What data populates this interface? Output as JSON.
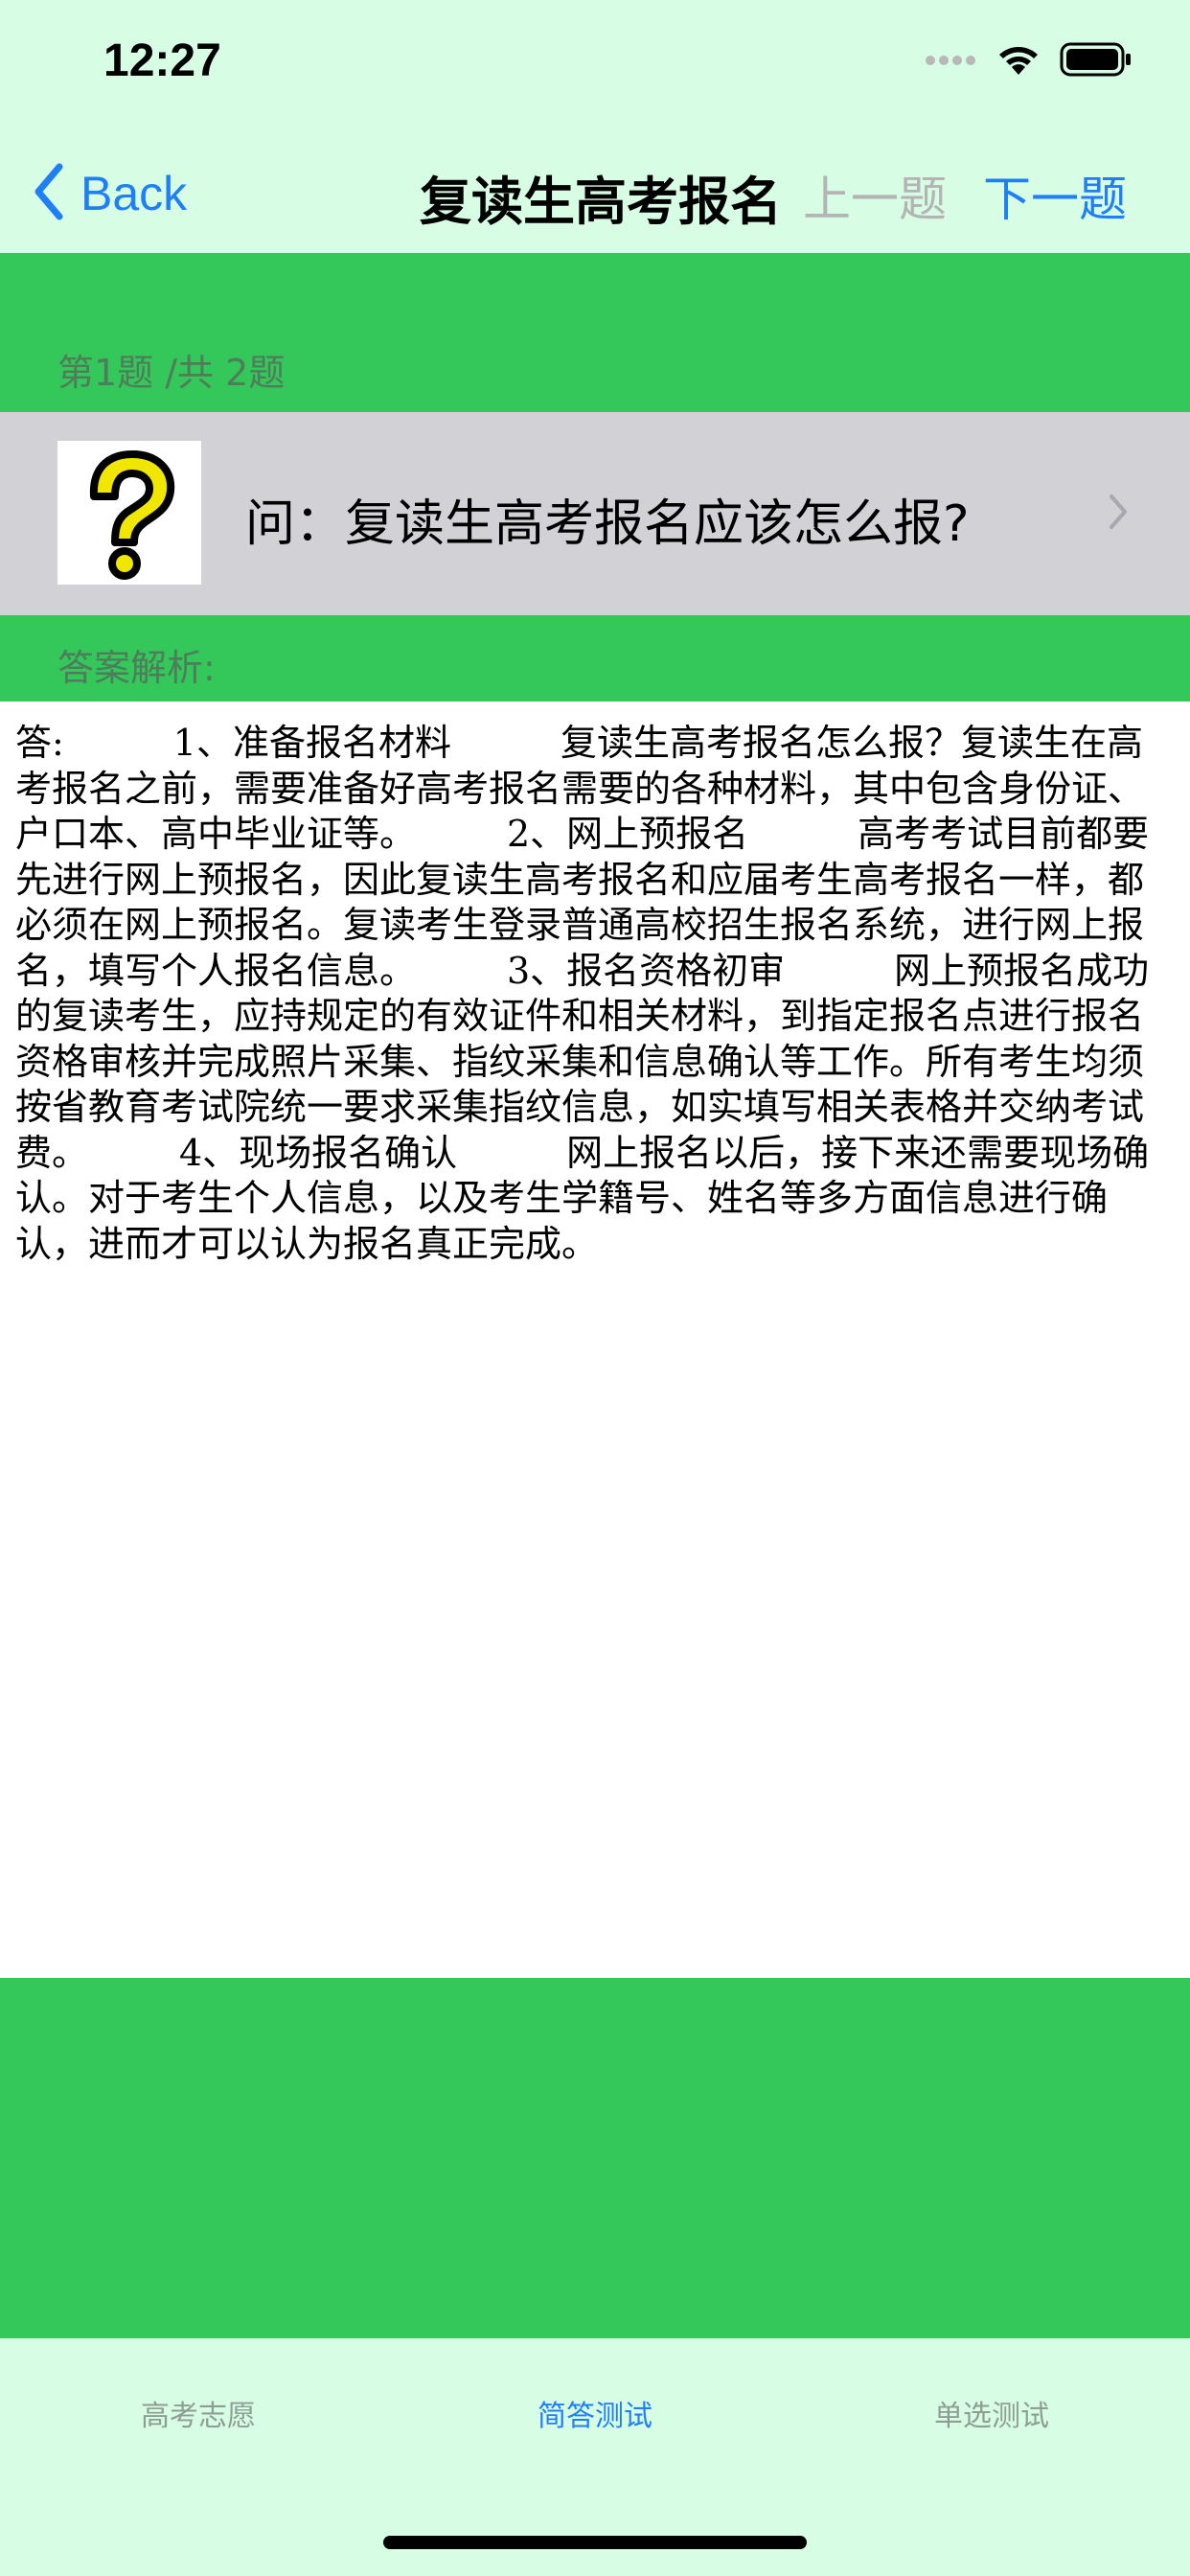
{
  "status_bar": {
    "time": "12:27"
  },
  "nav": {
    "back_label": "Back",
    "title": "复读生高考报名",
    "prev_label": "上一题",
    "next_label": "下一题"
  },
  "progress": {
    "label": "第1题 /共 2题"
  },
  "question": {
    "text": "问：复读生高考报名应该怎么报?"
  },
  "answer": {
    "header": "答案解析:",
    "body": "答:　　　1、准备报名材料　　　复读生高考报名怎么报？复读生在高考报名之前，需要准备好高考报名需要的各种材料，其中包含身份证、户口本、高中毕业证等。　　　2、网上预报名　　　高考考试目前都要先进行网上预报名，因此复读生高考报名和应届考生高考报名一样，都必须在网上预报名。复读考生登录普通高校招生报名系统，进行网上报名，填写个人报名信息。　　　3、报名资格初审　　　网上预报名成功的复读考生，应持规定的有效证件和相关材料，到指定报名点进行报名资格审核并完成照片采集、指纹采集和信息确认等工作。所有考生均须按省教育考试院统一要求采集指纹信息，如实填写相关表格并交纳考试费。　　　4、现场报名确认　　　网上报名以后，接下来还需要现场确认。对于考生个人信息，以及考生学籍号、姓名等多方面信息进行确认，进而才可以认为报名真正完成。"
  },
  "tabs": [
    {
      "label": "高考志愿"
    },
    {
      "label": "简答测试"
    },
    {
      "label": "单选测试"
    }
  ],
  "active_tab": "简答测试",
  "icons": {
    "signal": "cellular-signal-icon",
    "wifi": "wifi-icon",
    "battery": "battery-icon",
    "back": "chevron-left-icon",
    "question": "question-mark-icon",
    "row": "chevron-right-icon"
  },
  "colors": {
    "accent": "#1e7ff6",
    "green": "#34c759",
    "mint": "#d7fde4",
    "row_gray": "#d1d1d6",
    "disabled": "#b4b4b4"
  }
}
